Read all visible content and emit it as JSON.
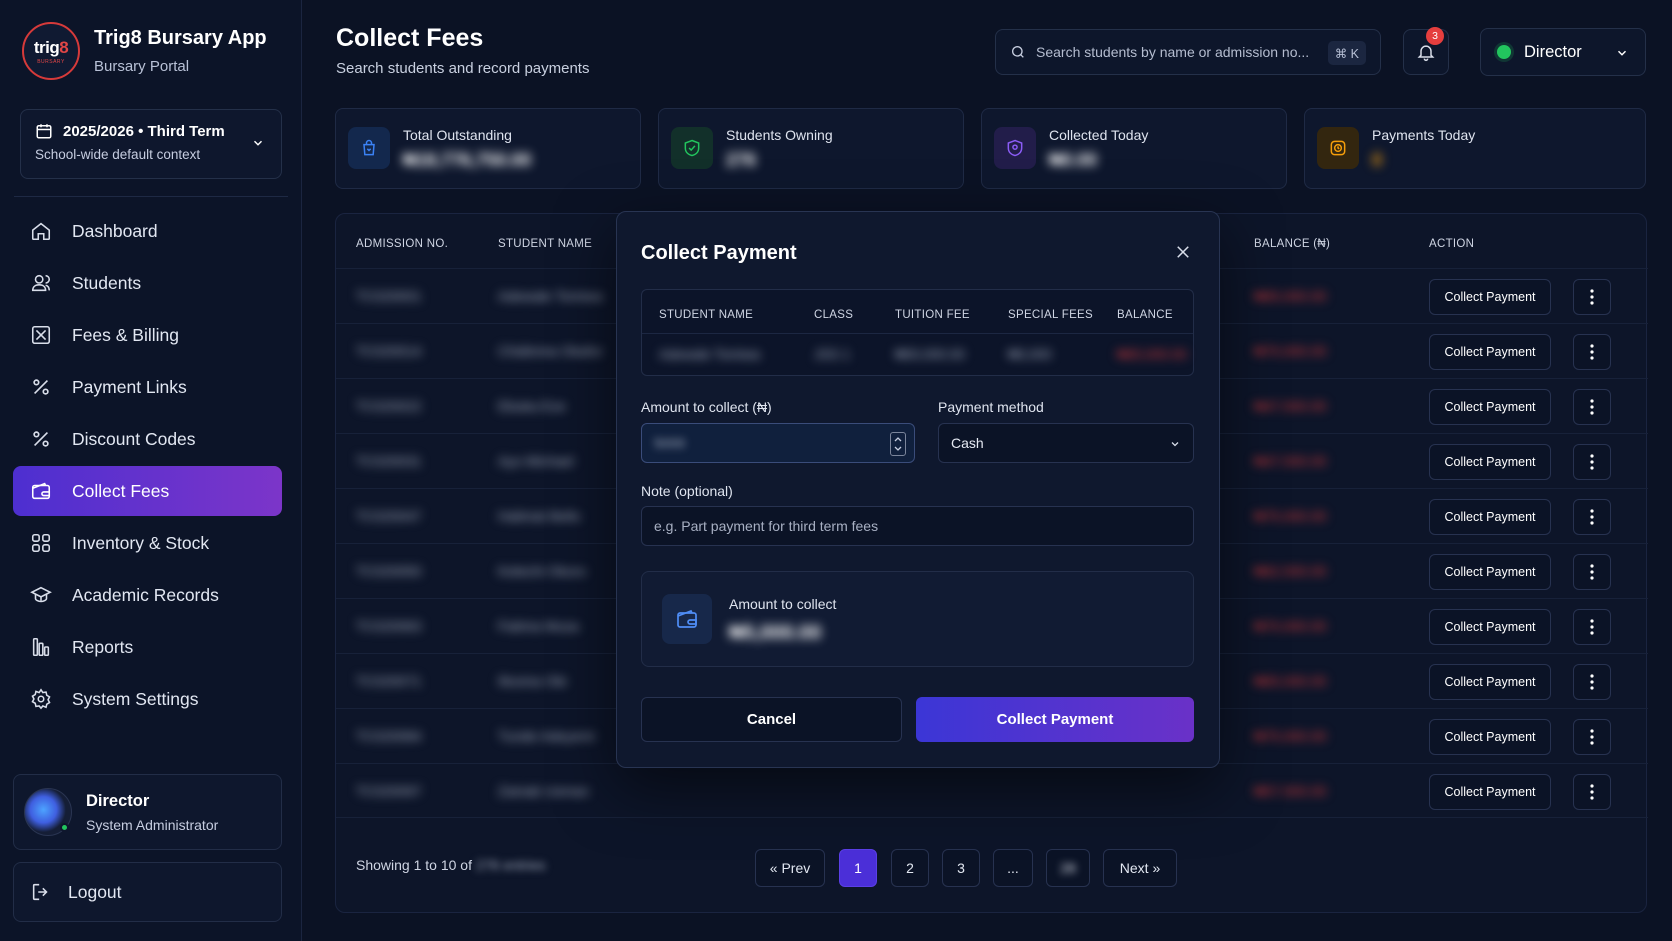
{
  "app": {
    "brand_title": "Trig8 Bursary App",
    "brand_sub": "Bursary Portal",
    "logo_text_main": "trig",
    "logo_text_accent": "8",
    "logo_text_small": "BURSARY"
  },
  "term": {
    "title": "2025/2026 • Third Term",
    "subtitle": "School-wide default context"
  },
  "sidebar": {
    "items": [
      {
        "label": "Dashboard",
        "icon": "home-icon"
      },
      {
        "label": "Students",
        "icon": "users-icon"
      },
      {
        "label": "Fees & Billing",
        "icon": "receipt-icon"
      },
      {
        "label": "Payment Links",
        "icon": "percent-icon"
      },
      {
        "label": "Discount Codes",
        "icon": "percent-icon"
      },
      {
        "label": "Collect Fees",
        "icon": "wallet-icon",
        "active": true
      },
      {
        "label": "Inventory & Stock",
        "icon": "grid-icon"
      },
      {
        "label": "Academic Records",
        "icon": "graduation-cap-icon"
      },
      {
        "label": "Reports",
        "icon": "bar-chart-icon"
      },
      {
        "label": "System Settings",
        "icon": "gear-icon"
      }
    ]
  },
  "user": {
    "name": "Director",
    "role": "System Administrator"
  },
  "logout_label": "Logout",
  "header": {
    "title": "Collect Fees",
    "subtitle": "Search students and record payments",
    "search_placeholder": "Search students by name or admission no...",
    "search_shortcut": "⌘ K",
    "notification_count": "3",
    "role_label": "Director"
  },
  "stats": [
    {
      "label": "Total Outstanding",
      "value": "₦18,776,750.00",
      "icon": "bag-icon",
      "color": "#3b82f6"
    },
    {
      "label": "Students Owning",
      "value": "276",
      "icon": "shield-check-icon",
      "color": "#22c55e"
    },
    {
      "label": "Collected Today",
      "value": "₦0.00",
      "icon": "shield-icon",
      "color": "#8b5cf6"
    },
    {
      "label": "Payments Today",
      "value": "0",
      "icon": "clock-icon",
      "color": "#f59e0b"
    }
  ],
  "table": {
    "headers": {
      "admission": "ADMISSION NO.",
      "name": "STUDENT NAME",
      "balance": "BALANCE (₦)",
      "action": "ACTION"
    },
    "rows": [
      {
        "admission": "TC020001",
        "name": "Adewale Tomiwa",
        "balance": "₦65,000.00"
      },
      {
        "admission": "TC020014",
        "name": "Chidinma Okafor",
        "balance": "₦70,000.00"
      },
      {
        "admission": "TC020022",
        "name": "Ebuka Eze",
        "balance": "₦47,500.00"
      },
      {
        "admission": "TC020031",
        "name": "Ayo Michael",
        "balance": "₦47,500.00"
      },
      {
        "admission": "TC020047",
        "name": "Halimat Bello",
        "balance": "₦75,000.00"
      },
      {
        "admission": "TC020050",
        "name": "Kelechi Okoro",
        "balance": "₦62,500.00"
      },
      {
        "admission": "TC020063",
        "name": "Fatima Musa",
        "balance": "₦70,000.00"
      },
      {
        "admission": "TC020071",
        "name": "Ifeoma Obi",
        "balance": "₦65,000.00"
      },
      {
        "admission": "TC020084",
        "name": "Tunde Adeyemi",
        "balance": "₦75,000.00"
      },
      {
        "admission": "TC020097",
        "name": "Zainab Usman",
        "balance": "₦57,500.00"
      }
    ],
    "row_action_label": "Collect Payment"
  },
  "pagination": {
    "showing_prefix": "Showing 1 to 10 of",
    "total": "276 entries",
    "prev": "« Prev",
    "pages": [
      "1",
      "2",
      "3",
      "..."
    ],
    "last_page": "28",
    "next": "Next »"
  },
  "modal": {
    "title": "Collect Payment",
    "student_table": {
      "headers": [
        "STUDENT NAME",
        "CLASS",
        "TUITION FEE",
        "SPECIAL FEES",
        "BALANCE"
      ],
      "row": [
        "Adewale Tomiwa",
        "JSS 1",
        "₦50,000.00",
        "₦5,000",
        "₦65,000.00"
      ]
    },
    "amount_label": "Amount to collect (₦)",
    "amount_value": "5000",
    "method_label": "Payment method",
    "method_value": "Cash",
    "note_label": "Note (optional)",
    "note_placeholder": "e.g. Part payment for third term fees",
    "summary_label": "Amount to collect",
    "summary_value": "₦5,000.00",
    "cancel_label": "Cancel",
    "collect_label": "Collect Payment"
  },
  "colors": {
    "accent_start": "#4d2fd0",
    "accent_end": "#7c35c9",
    "danger": "#d93a3a",
    "success": "#22c55e"
  }
}
